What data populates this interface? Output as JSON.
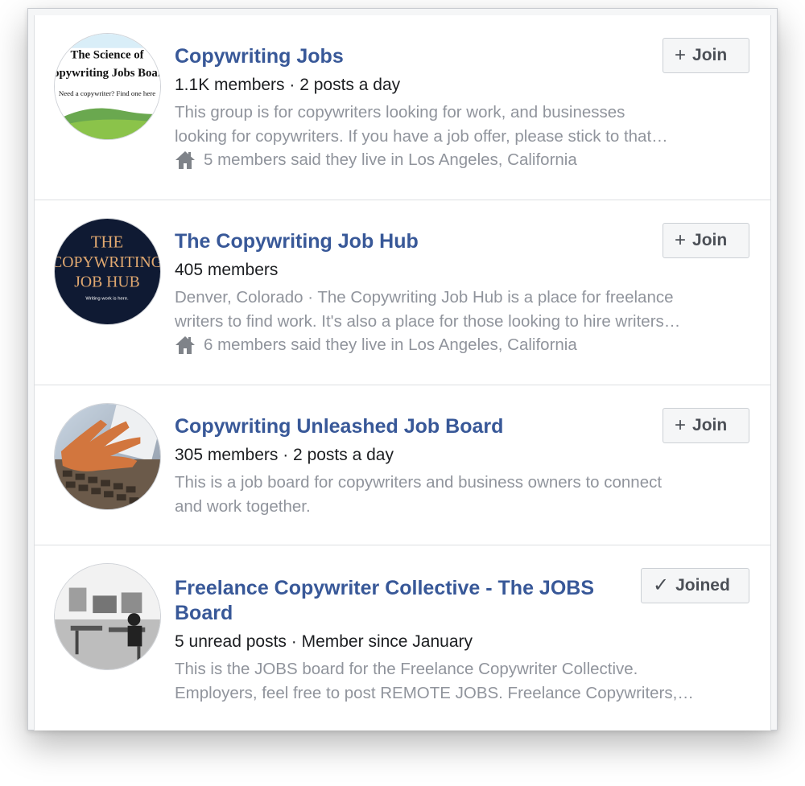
{
  "groups": [
    {
      "title": "Copywriting Jobs",
      "meta": "1.1K members · 2 posts a day",
      "description_lines": [
        "This group is for copywriters looking for work, and businesses",
        "looking for copywriters. If you have a job offer, please stick to that…"
      ],
      "location_note": "5 members said they live in Los Angeles, California",
      "action": {
        "icon": "+",
        "label": "Join"
      },
      "avatar_text": [
        "The Science of",
        "Copywriting Jobs Board",
        "Need a copywriter? Find one here"
      ]
    },
    {
      "title": "The Copywriting Job Hub",
      "meta": "405 members",
      "description_lines": [
        "Denver, Colorado · The Copywriting Job Hub is a place for freelance",
        "writers to find work. It's also a place for those looking to hire writers…"
      ],
      "location_note": "6 members said they live in Los Angeles, California",
      "action": {
        "icon": "+",
        "label": "Join"
      },
      "avatar_text": [
        "THE",
        "COPYWRITING",
        "JOB HUB",
        "Writing work is here."
      ]
    },
    {
      "title": "Copywriting Unleashed Job Board",
      "meta": "305 members · 2 posts a day",
      "description_lines": [
        "This is a job board for copywriters and business owners to connect",
        "and work together."
      ],
      "action": {
        "icon": "+",
        "label": "Join"
      }
    },
    {
      "title": "Freelance Copywriter Collective - The JOBS Board",
      "meta": "5 unread posts · Member since January",
      "description_lines": [
        "This is the JOBS board for the Freelance Copywriter Collective.",
        "Employers, feel free to post REMOTE JOBS. Freelance Copywriters,…"
      ],
      "action": {
        "icon": "✓",
        "label": "Joined"
      }
    }
  ],
  "colors": {
    "title": "#385898",
    "meta": "#1c1e21",
    "muted": "#90949c",
    "button_bg": "#f5f6f7",
    "button_text": "#4b4f56"
  },
  "icons": {
    "location": "home-icon",
    "join": "plus-icon",
    "joined": "checkmark-icon"
  }
}
